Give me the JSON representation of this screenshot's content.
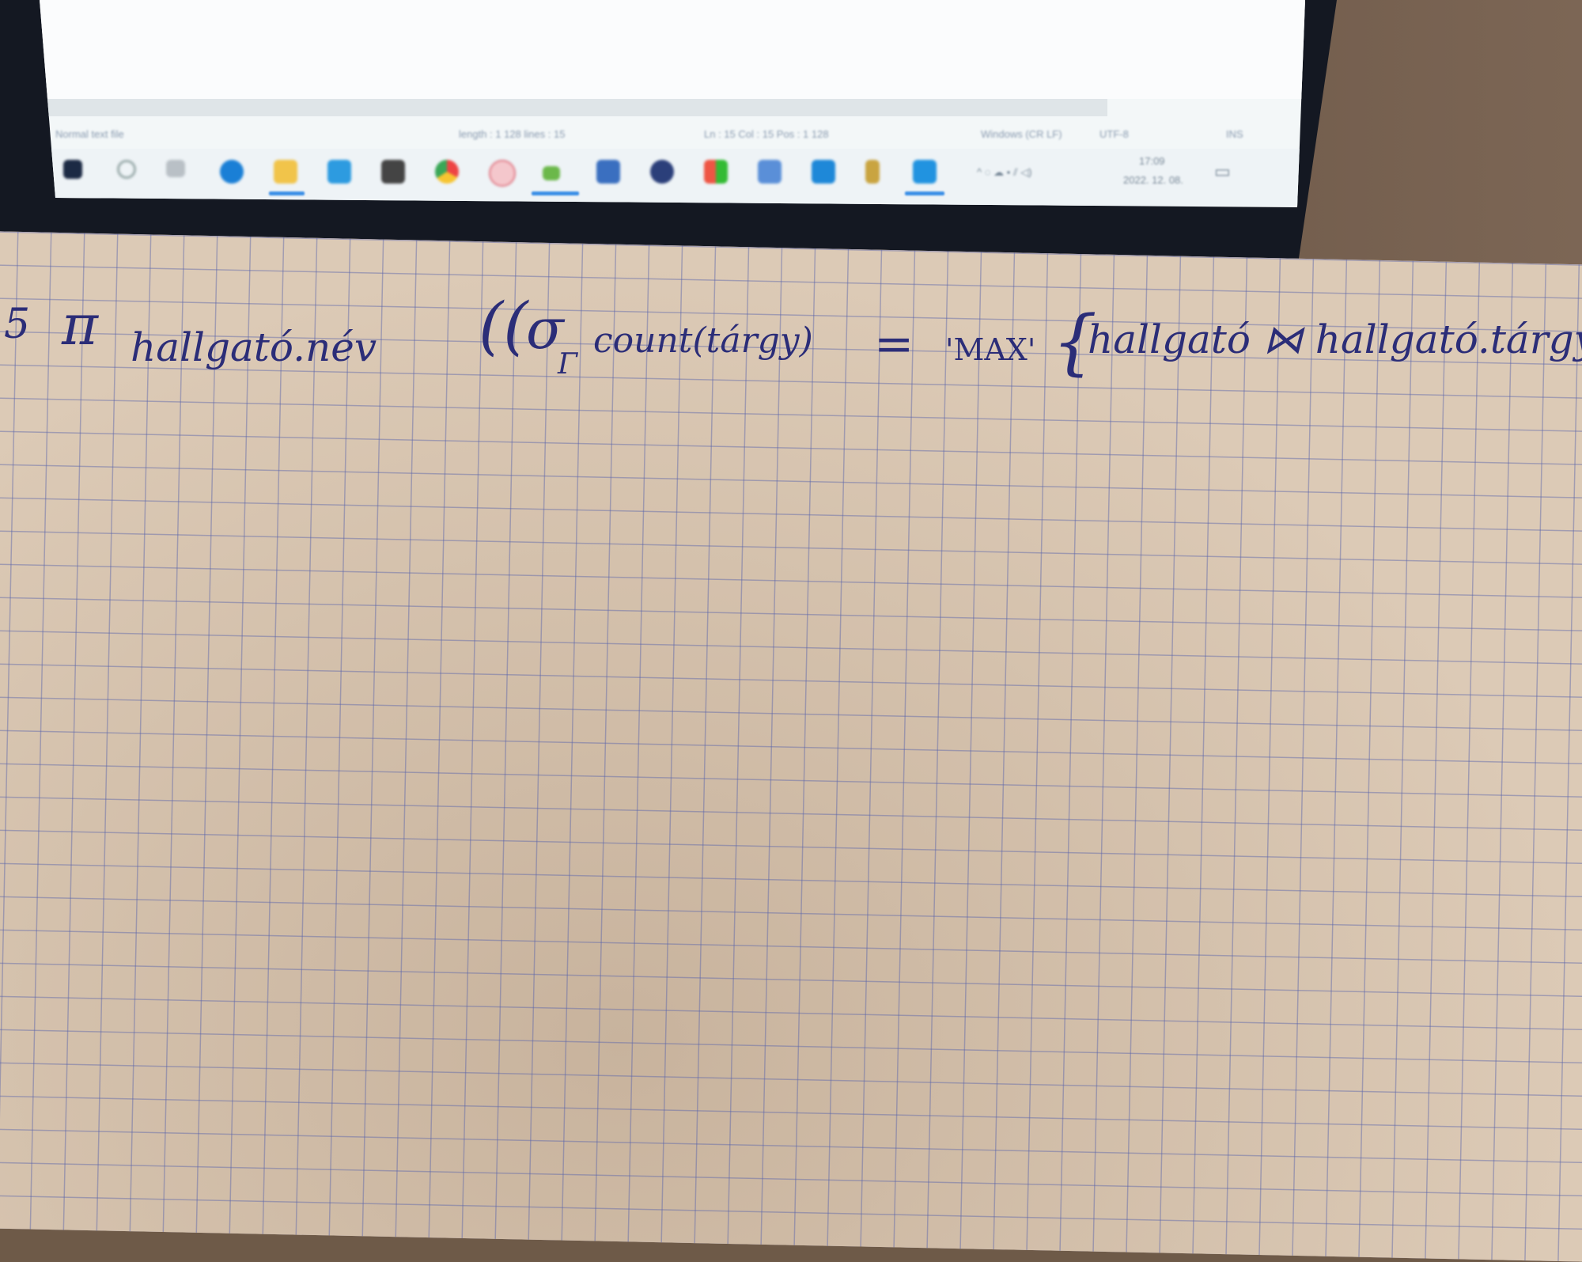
{
  "editor_status": {
    "file_type": "Normal text file",
    "length_lines": "length : 1 128   lines : 15",
    "position": "Ln : 15   Col : 15   Pos : 1 128",
    "eol": "Windows (CR LF)",
    "encoding": "UTF-8",
    "mode": "INS"
  },
  "taskbar": {
    "icons": [
      "windows-start",
      "search",
      "task-view",
      "edge",
      "file-explorer",
      "mail",
      "dropbox",
      "chrome",
      "app-red",
      "app-green",
      "app-save",
      "app-globe",
      "app-office",
      "app-blue",
      "app-docs",
      "app-paint",
      "app-vscode"
    ],
    "clock_time": "17:09",
    "clock_date": "2022. 12. 08."
  },
  "handwriting": {
    "number": "5",
    "pi": "π",
    "projection": "hallgató.név",
    "open": "((",
    "sigma": "σ",
    "subscript": "Γ",
    "condition": "count(tárgy)",
    "equals": "=",
    "value": "'MAX'",
    "brace": "{",
    "relation": "hallgató ⋈ hallgató.tárgy"
  }
}
